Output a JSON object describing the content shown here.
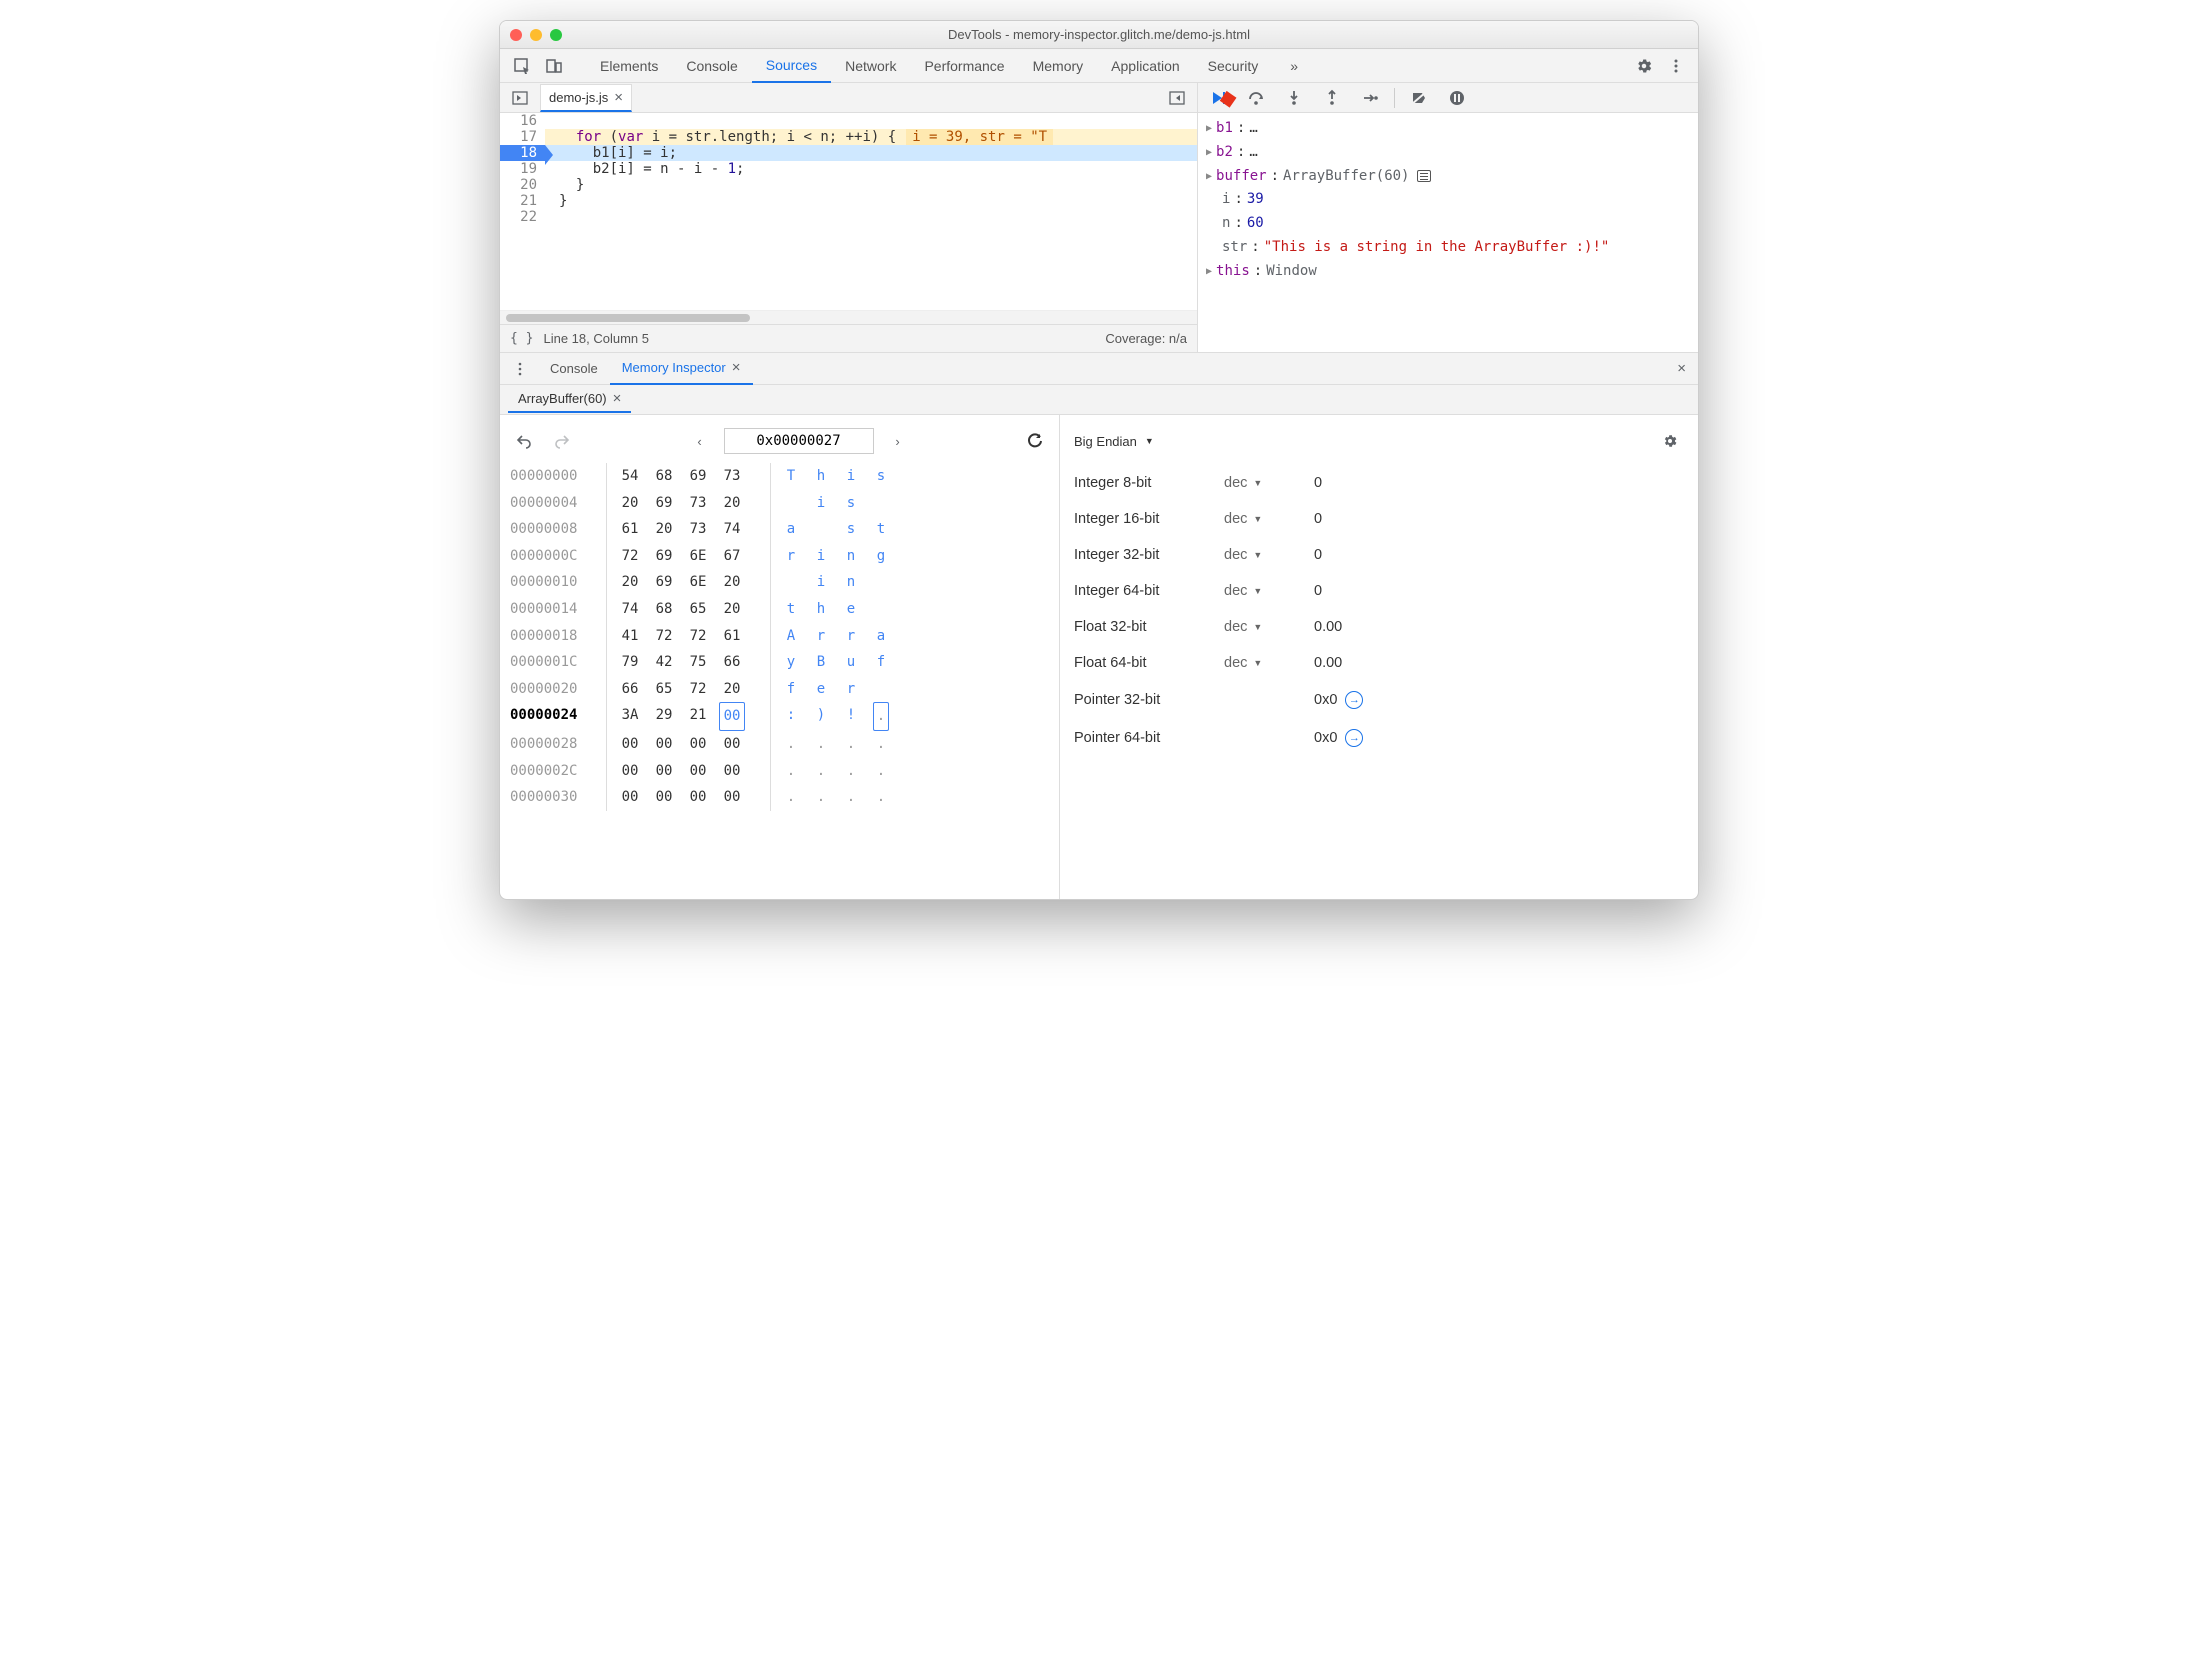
{
  "window": {
    "title": "DevTools - memory-inspector.glitch.me/demo-js.html"
  },
  "main_tabs": {
    "items": [
      "Elements",
      "Console",
      "Sources",
      "Network",
      "Performance",
      "Memory",
      "Application",
      "Security"
    ],
    "active": "Sources",
    "overflow": "»"
  },
  "file_tab": {
    "name": "demo-js.js"
  },
  "code": {
    "lines": [
      {
        "num": 16,
        "text": ""
      },
      {
        "num": 17,
        "text_html": "  <span class='kw'>for</span> (<span class='kw'>var</span> i = str.length; i &lt; n; ++i) {",
        "inline": "i = 39, str = \"T"
      },
      {
        "num": 18,
        "text_html": "    b1[i] = i;",
        "bp": true
      },
      {
        "num": 19,
        "text_html": "    b2[i] = n - i - <span class='num'>1</span>;"
      },
      {
        "num": 20,
        "text_html": "  }"
      },
      {
        "num": 21,
        "text_html": "}"
      },
      {
        "num": 22,
        "text_html": ""
      }
    ]
  },
  "status": {
    "cursor": "Line 18, Column 5",
    "coverage": "Coverage: n/a"
  },
  "scope": {
    "b1": "…",
    "b2": "…",
    "buffer_label": "buffer",
    "buffer_type": "ArrayBuffer(60)",
    "i": "39",
    "n": "60",
    "str": "\"This is a string in the ArrayBuffer :)!\"",
    "this_label": "this",
    "this_val": "Window"
  },
  "drawer": {
    "tabs": [
      "Console",
      "Memory Inspector"
    ],
    "active": "Memory Inspector"
  },
  "mi_tab": {
    "label": "ArrayBuffer(60)"
  },
  "hex": {
    "address": "0x00000027",
    "rows": [
      {
        "addr": "00000000",
        "bytes": [
          "54",
          "68",
          "69",
          "73"
        ],
        "ascii": [
          "T",
          "h",
          "i",
          "s"
        ]
      },
      {
        "addr": "00000004",
        "bytes": [
          "20",
          "69",
          "73",
          "20"
        ],
        "ascii": [
          " ",
          "i",
          "s",
          " "
        ]
      },
      {
        "addr": "00000008",
        "bytes": [
          "61",
          "20",
          "73",
          "74"
        ],
        "ascii": [
          "a",
          " ",
          "s",
          "t"
        ]
      },
      {
        "addr": "0000000C",
        "bytes": [
          "72",
          "69",
          "6E",
          "67"
        ],
        "ascii": [
          "r",
          "i",
          "n",
          "g"
        ]
      },
      {
        "addr": "00000010",
        "bytes": [
          "20",
          "69",
          "6E",
          "20"
        ],
        "ascii": [
          " ",
          "i",
          "n",
          " "
        ]
      },
      {
        "addr": "00000014",
        "bytes": [
          "74",
          "68",
          "65",
          "20"
        ],
        "ascii": [
          "t",
          "h",
          "e",
          " "
        ]
      },
      {
        "addr": "00000018",
        "bytes": [
          "41",
          "72",
          "72",
          "61"
        ],
        "ascii": [
          "A",
          "r",
          "r",
          "a"
        ]
      },
      {
        "addr": "0000001C",
        "bytes": [
          "79",
          "42",
          "75",
          "66"
        ],
        "ascii": [
          "y",
          "B",
          "u",
          "f"
        ]
      },
      {
        "addr": "00000020",
        "bytes": [
          "66",
          "65",
          "72",
          "20"
        ],
        "ascii": [
          "f",
          "e",
          "r",
          " "
        ]
      },
      {
        "addr": "00000024",
        "bytes": [
          "3A",
          "29",
          "21",
          "00"
        ],
        "ascii": [
          ":",
          ")",
          "!",
          "."
        ],
        "bold": true,
        "sel": 3
      },
      {
        "addr": "00000028",
        "bytes": [
          "00",
          "00",
          "00",
          "00"
        ],
        "ascii": [
          ".",
          ".",
          ".",
          "."
        ]
      },
      {
        "addr": "0000002C",
        "bytes": [
          "00",
          "00",
          "00",
          "00"
        ],
        "ascii": [
          ".",
          ".",
          ".",
          "."
        ]
      },
      {
        "addr": "00000030",
        "bytes": [
          "00",
          "00",
          "00",
          "00"
        ],
        "ascii": [
          ".",
          ".",
          ".",
          "."
        ]
      }
    ]
  },
  "values": {
    "endian_label": "Big Endian",
    "rows": [
      {
        "label": "Integer 8-bit",
        "mode": "dec",
        "value": "0"
      },
      {
        "label": "Integer 16-bit",
        "mode": "dec",
        "value": "0"
      },
      {
        "label": "Integer 32-bit",
        "mode": "dec",
        "value": "0"
      },
      {
        "label": "Integer 64-bit",
        "mode": "dec",
        "value": "0"
      },
      {
        "label": "Float 32-bit",
        "mode": "dec",
        "value": "0.00"
      },
      {
        "label": "Float 64-bit",
        "mode": "dec",
        "value": "0.00"
      },
      {
        "label": "Pointer 32-bit",
        "mode": "",
        "value": "0x0",
        "jump": true
      },
      {
        "label": "Pointer 64-bit",
        "mode": "",
        "value": "0x0",
        "jump": true
      }
    ]
  }
}
